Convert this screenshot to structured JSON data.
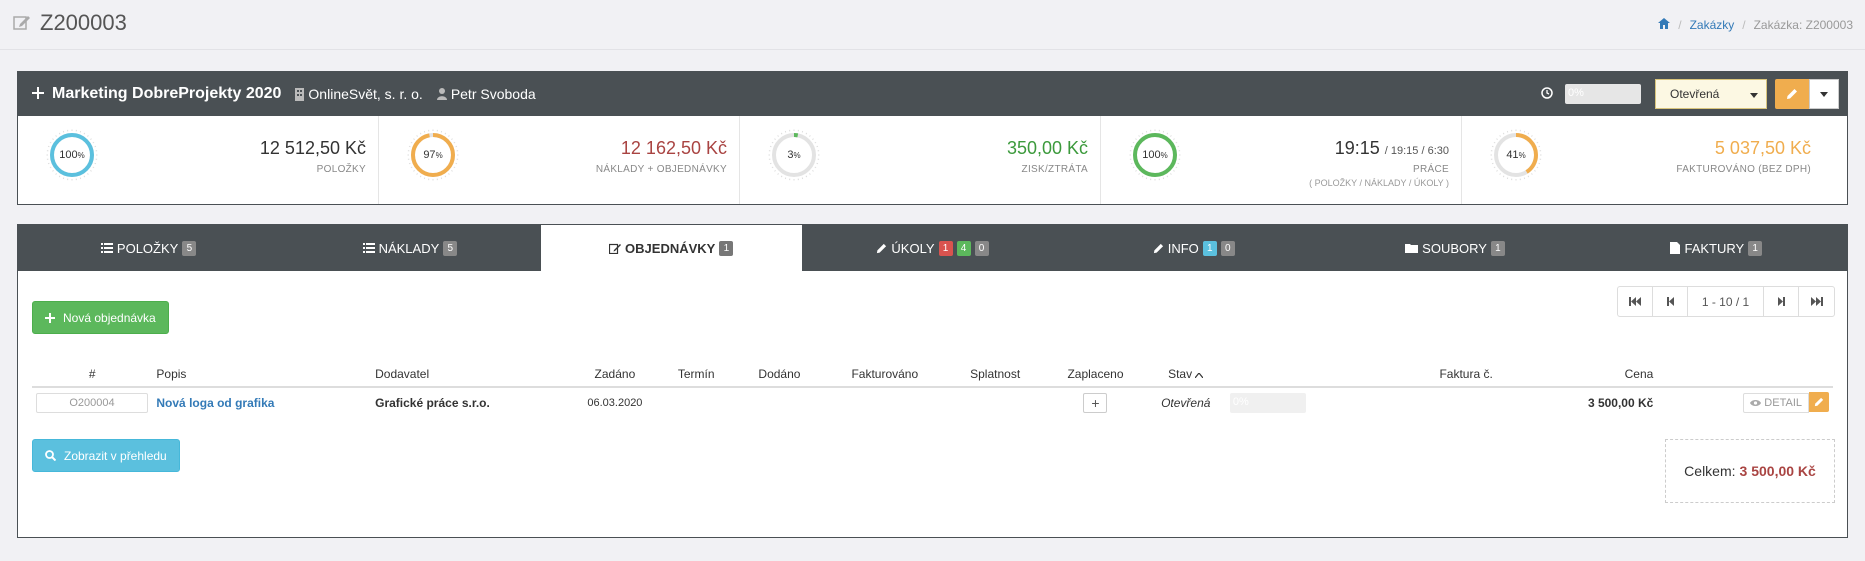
{
  "page": {
    "title": "Z200003"
  },
  "breadcrumb": {
    "items": [
      "Zakázky",
      "Zakázka: Z200003"
    ]
  },
  "project": {
    "name": "Marketing DobreProjekty 2020",
    "company": "OnlineSvět, s. r. o.",
    "person": "Petr Svoboda",
    "progress_label": "0%",
    "progress": 0,
    "status": "Otevřená"
  },
  "stats": [
    {
      "pct": "100",
      "pct_value": 100,
      "color": "#5bc0de",
      "value": "12 512,50 Kč",
      "value_color": "#333333",
      "label": "POLOŽKY"
    },
    {
      "pct": "97",
      "pct_value": 97,
      "color": "#f0ad4e",
      "value": "12 162,50 Kč",
      "value_color": "#a94442",
      "label": "NÁKLADY + OBJEDNÁVKY"
    },
    {
      "pct": "3",
      "pct_value": 3,
      "color": "#5cb85c",
      "value": "350,00 Kč",
      "value_color": "#3c9a3c",
      "label": "ZISK/ZTRÁTA"
    },
    {
      "pct": "100",
      "pct_value": 100,
      "color": "#5cb85c",
      "value": "19:15",
      "value_small": "/ 19:15 / 6:30",
      "value_color": "#333333",
      "label": "PRÁCE",
      "sub": "( POLOŽKY / NÁKLADY / ÚKOLY )"
    },
    {
      "pct": "41",
      "pct_value": 41,
      "color": "#f0ad4e",
      "value": "5 037,50 Kč",
      "value_color": "#f0ad4e",
      "label": "FAKTUROVÁNO (BEZ DPH)"
    }
  ],
  "tabs": [
    {
      "label": "POLOŽKY",
      "badges": [
        "5"
      ]
    },
    {
      "label": "NÁKLADY",
      "badges": [
        "5"
      ]
    },
    {
      "label": "OBJEDNÁVKY",
      "badges": [
        "1"
      ]
    },
    {
      "label": "ÚKOLY",
      "badges": [
        "1",
        "4",
        "0"
      ]
    },
    {
      "label": "INFO",
      "badges": [
        "1",
        "0"
      ]
    },
    {
      "label": "SOUBORY",
      "badges": [
        "1"
      ]
    },
    {
      "label": "FAKTURY",
      "badges": [
        "1"
      ]
    }
  ],
  "actions": {
    "new_order": "Nová objednávka",
    "show_overview": "Zobrazit v přehledu"
  },
  "pager": {
    "info": "1 - 10 / 1"
  },
  "table": {
    "headers": [
      "#",
      "Popis",
      "Dodavatel",
      "Zadáno",
      "Termín",
      "Dodáno",
      "Fakturováno",
      "Splatnost",
      "Zaplaceno",
      "Stav",
      "",
      "Faktura č.",
      "Cena",
      ""
    ],
    "rows": [
      {
        "code": "O200004",
        "description": "Nová loga od grafika",
        "supplier": "Grafické práce s.r.o.",
        "ordered": "06.03.2020",
        "deadline": "",
        "delivered": "",
        "invoiced": "",
        "due": "",
        "state": "Otevřená",
        "progress_label": "0%",
        "progress": 0,
        "invoice_no": "",
        "price": "3 500,00 Kč",
        "detail_label": "DETAIL"
      }
    ]
  },
  "total": {
    "label": "Celkem:",
    "amount": "3 500,00 Kč"
  }
}
